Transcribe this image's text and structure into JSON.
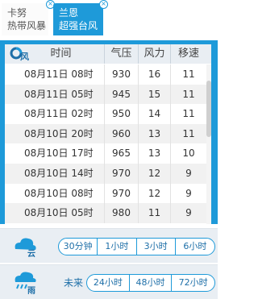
{
  "tabs": [
    {
      "line1": "卡努",
      "line2": "热带风暴"
    },
    {
      "line1": "兰恩",
      "line2": "超强台风"
    }
  ],
  "close_glyph": "×",
  "table": {
    "headers": {
      "time": "时间",
      "pressure": "气压",
      "wind": "风力",
      "speed": "移速"
    },
    "rows": [
      {
        "time": "08月11日 08时",
        "pressure": "930",
        "wind": "16",
        "speed": "11"
      },
      {
        "time": "08月11日 05时",
        "pressure": "945",
        "wind": "15",
        "speed": "11"
      },
      {
        "time": "08月11日 02时",
        "pressure": "950",
        "wind": "14",
        "speed": "11"
      },
      {
        "time": "08月10日 20时",
        "pressure": "960",
        "wind": "13",
        "speed": "11"
      },
      {
        "time": "08月10日 17时",
        "pressure": "965",
        "wind": "13",
        "speed": "10"
      },
      {
        "time": "08月10日 14时",
        "pressure": "970",
        "wind": "12",
        "speed": "9"
      },
      {
        "time": "08月10日 08时",
        "pressure": "970",
        "wind": "12",
        "speed": "9"
      },
      {
        "time": "08月10日 05时",
        "pressure": "980",
        "wind": "11",
        "speed": "9"
      }
    ],
    "icon_label": "风"
  },
  "cloud_panel": {
    "icon_label": "云",
    "options": [
      "30分钟",
      "1小时",
      "3小时",
      "6小时"
    ]
  },
  "rain_panel": {
    "icon_label": "雨",
    "future_label": "未来",
    "options": [
      "24小时",
      "48小时",
      "72小时"
    ]
  },
  "colors": {
    "accent": "#1e9ad9",
    "header_bg": "#e9eef3",
    "row_alt": "#f1f1f1"
  }
}
